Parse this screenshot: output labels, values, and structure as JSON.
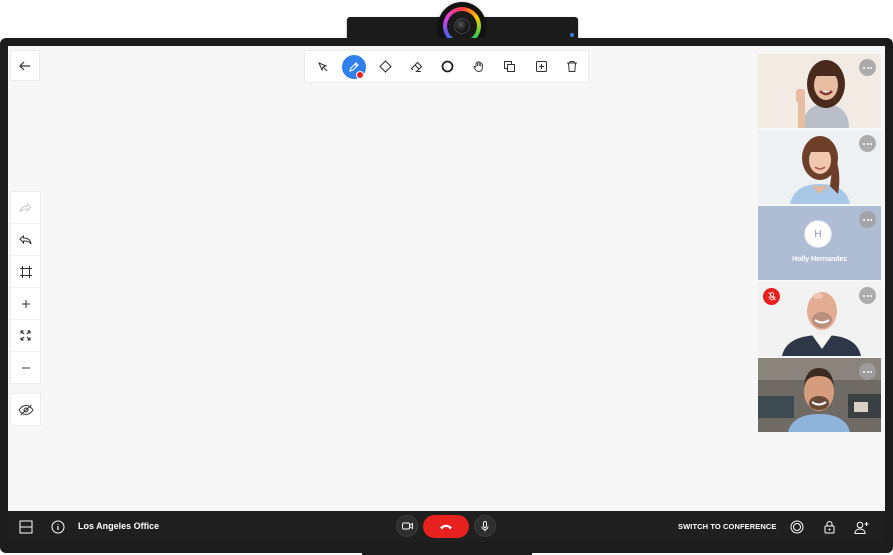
{
  "toolbar": {
    "tools": [
      {
        "id": "select",
        "icon": "pointer-icon"
      },
      {
        "id": "pen",
        "icon": "pen-icon",
        "active": true
      },
      {
        "id": "shape",
        "icon": "diamond-icon"
      },
      {
        "id": "eraser",
        "icon": "eraser-icon"
      },
      {
        "id": "circle",
        "icon": "circle-icon"
      },
      {
        "id": "pan",
        "icon": "hand-icon"
      },
      {
        "id": "layers",
        "icon": "layers-icon"
      },
      {
        "id": "add-frame",
        "icon": "add-square-icon"
      },
      {
        "id": "delete",
        "icon": "trash-icon"
      }
    ],
    "active_color": "#2f80ed",
    "pen_color": "#e8201e"
  },
  "side_tools": [
    "redo-icon",
    "undo-icon",
    "crop-icon",
    "zoom-in-icon",
    "fit-icon",
    "zoom-out-icon",
    "hide-icon"
  ],
  "participants": [
    {
      "id": "p1",
      "type": "video"
    },
    {
      "id": "p2",
      "type": "video"
    },
    {
      "id": "p3",
      "type": "avatar",
      "initial": "H",
      "name": "Holly Hernandez"
    },
    {
      "id": "p4",
      "type": "video",
      "muted": true
    },
    {
      "id": "p5",
      "type": "video"
    }
  ],
  "bottom_bar": {
    "location": "Los Angeles Office",
    "switch_label": "SWITCH TO CONFERENCE"
  },
  "colors": {
    "hangup": "#e8201e",
    "bar": "#1f1f1f"
  }
}
